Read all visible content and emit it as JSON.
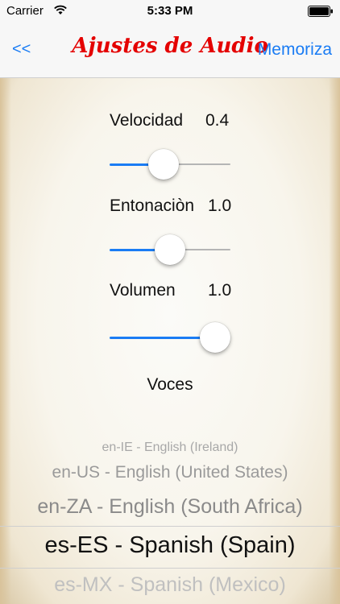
{
  "status_bar": {
    "carrier": "Carrier",
    "time": "5:33 PM"
  },
  "nav": {
    "back_label": "<<",
    "title": "Ajustes de Audio",
    "action_label": "Memoriza"
  },
  "settings": {
    "speed": {
      "label": "Velocidad",
      "value": "0.4",
      "slider_fraction": 0.43
    },
    "pitch": {
      "label": "Entonaciòn",
      "value": "1.0",
      "slider_fraction": 0.5
    },
    "volume": {
      "label": "Volumen",
      "value": "1.0",
      "slider_fraction": 1.0
    }
  },
  "voices": {
    "label": "Voces",
    "options": [
      "en-IE - English (Ireland)",
      "en-US - English (United States)",
      "en-ZA - English (South Africa)",
      "es-ES - Spanish (Spain)",
      "es-MX - Spanish (Mexico)"
    ],
    "selected": "es-ES - Spanish (Spain)"
  },
  "colors": {
    "accent": "#1a7cf4",
    "title_red": "#e40000"
  }
}
